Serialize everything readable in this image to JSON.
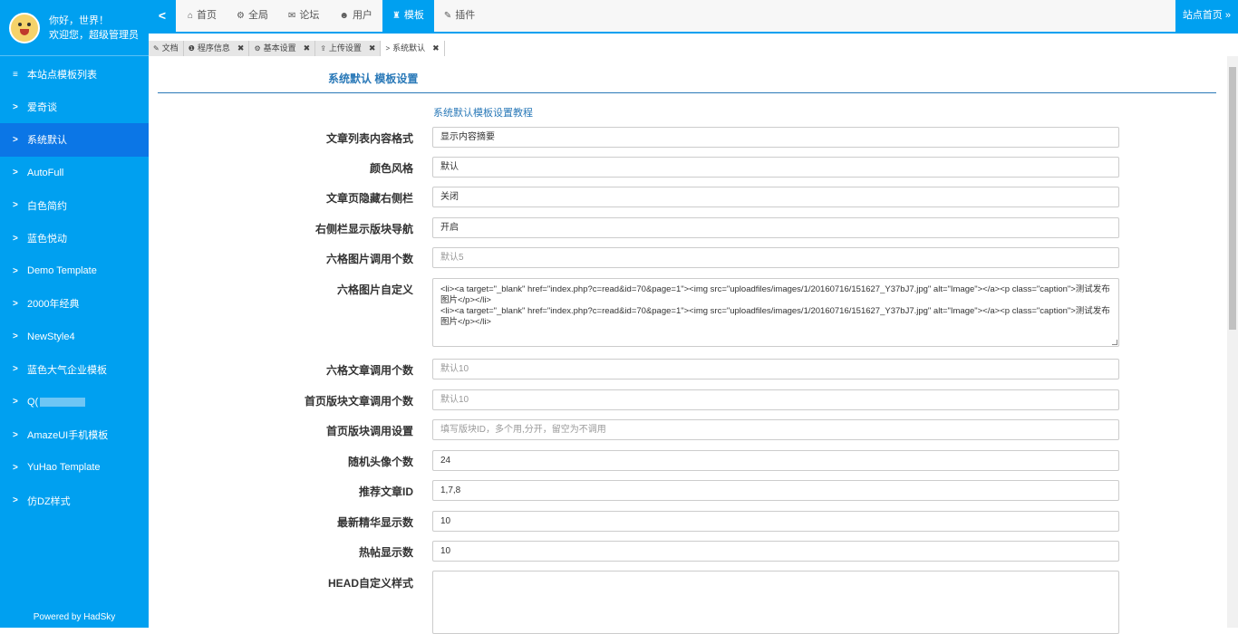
{
  "profile": {
    "greeting": "你好，世界！",
    "welcome": "欢迎您，超级管理员"
  },
  "sidebar": {
    "items": [
      {
        "icon": "≡",
        "label": "本站点模板列表",
        "active": false
      },
      {
        "icon": ">",
        "label": "爱奇谈",
        "active": false
      },
      {
        "icon": ">",
        "label": "系统默认",
        "active": true
      },
      {
        "icon": ">",
        "label": "AutoFull",
        "active": false
      },
      {
        "icon": ">",
        "label": "白色简约",
        "active": false
      },
      {
        "icon": ">",
        "label": "蓝色悦动",
        "active": false
      },
      {
        "icon": ">",
        "label": "Demo Template",
        "active": false
      },
      {
        "icon": ">",
        "label": "2000年经典",
        "active": false
      },
      {
        "icon": ">",
        "label": "NewStyle4",
        "active": false
      },
      {
        "icon": ">",
        "label": "蓝色大气企业模板",
        "active": false
      },
      {
        "icon": ">",
        "label": "Q(",
        "active": false
      },
      {
        "icon": ">",
        "label": "AmazeUI手机模板",
        "active": false
      },
      {
        "icon": ">",
        "label": "YuHao Template",
        "active": false
      },
      {
        "icon": ">",
        "label": "仿DZ样式",
        "active": false
      }
    ],
    "powered": "Powered by HadSky"
  },
  "topnav": {
    "toggle": "<",
    "items": [
      {
        "icon": "⌂",
        "label": "首页",
        "active": false
      },
      {
        "icon": "⚙",
        "label": "全局",
        "active": false
      },
      {
        "icon": "✉",
        "label": "论坛",
        "active": false
      },
      {
        "icon": "☻",
        "label": "用户",
        "active": false
      },
      {
        "icon": "♜",
        "label": "模板",
        "active": true
      },
      {
        "icon": "✎",
        "label": "插件",
        "active": false
      }
    ],
    "site_home": "站点首页 »"
  },
  "tabs": [
    {
      "icon": "✎",
      "label": "文档",
      "closable": false
    },
    {
      "icon": "❶",
      "label": "程序信息",
      "closable": true
    },
    {
      "icon": "⚙",
      "label": "基本设置",
      "closable": true
    },
    {
      "icon": "⇪",
      "label": "上传设置",
      "closable": true
    },
    {
      "icon": ">",
      "label": "系统默认",
      "closable": true,
      "active": true
    }
  ],
  "close_glyph": "✖",
  "page": {
    "heading": "系统默认 模板设置",
    "tutorial_link": "系统默认模板设置教程"
  },
  "form": {
    "list_format": {
      "label": "文章列表内容格式",
      "value": "显示内容摘要"
    },
    "color_style": {
      "label": "颜色风格",
      "value": "默认"
    },
    "hide_sidebar": {
      "label": "文章页隐藏右侧栏",
      "value": "关闭"
    },
    "sidebar_nav": {
      "label": "右侧栏显示版块导航",
      "value": "开启"
    },
    "grid_img_count": {
      "label": "六格图片调用个数",
      "placeholder": "默认5"
    },
    "grid_img_custom": {
      "label": "六格图片自定义",
      "value": "<li><a target=\"_blank\" href=\"index.php?c=read&id=70&page=1\"><img src=\"uploadfiles/images/1/20160716/151627_Y37bJ7.jpg\" alt=\"Image\"></a><p class=\"caption\">测试发布图片</p></li>\n<li><a target=\"_blank\" href=\"index.php?c=read&id=70&page=1\"><img src=\"uploadfiles/images/1/20160716/151627_Y37bJ7.jpg\" alt=\"Image\"></a><p class=\"caption\">测试发布图片</p></li>"
    },
    "grid_article_count": {
      "label": "六格文章调用个数",
      "placeholder": "默认10"
    },
    "home_block_article_count": {
      "label": "首页版块文章调用个数",
      "placeholder": "默认10"
    },
    "home_block_setting": {
      "label": "首页版块调用设置",
      "placeholder": "填写版块ID，多个用,分开，留空为不调用"
    },
    "random_avatar": {
      "label": "随机头像个数",
      "value": "24"
    },
    "recommend_ids": {
      "label": "推荐文章ID",
      "value": "1,7,8"
    },
    "latest_essence": {
      "label": "最新精华显示数",
      "value": "10"
    },
    "hot_posts": {
      "label": "热帖显示数",
      "value": "10"
    },
    "head_custom_style": {
      "label": "HEAD自定义样式",
      "value": ""
    }
  }
}
